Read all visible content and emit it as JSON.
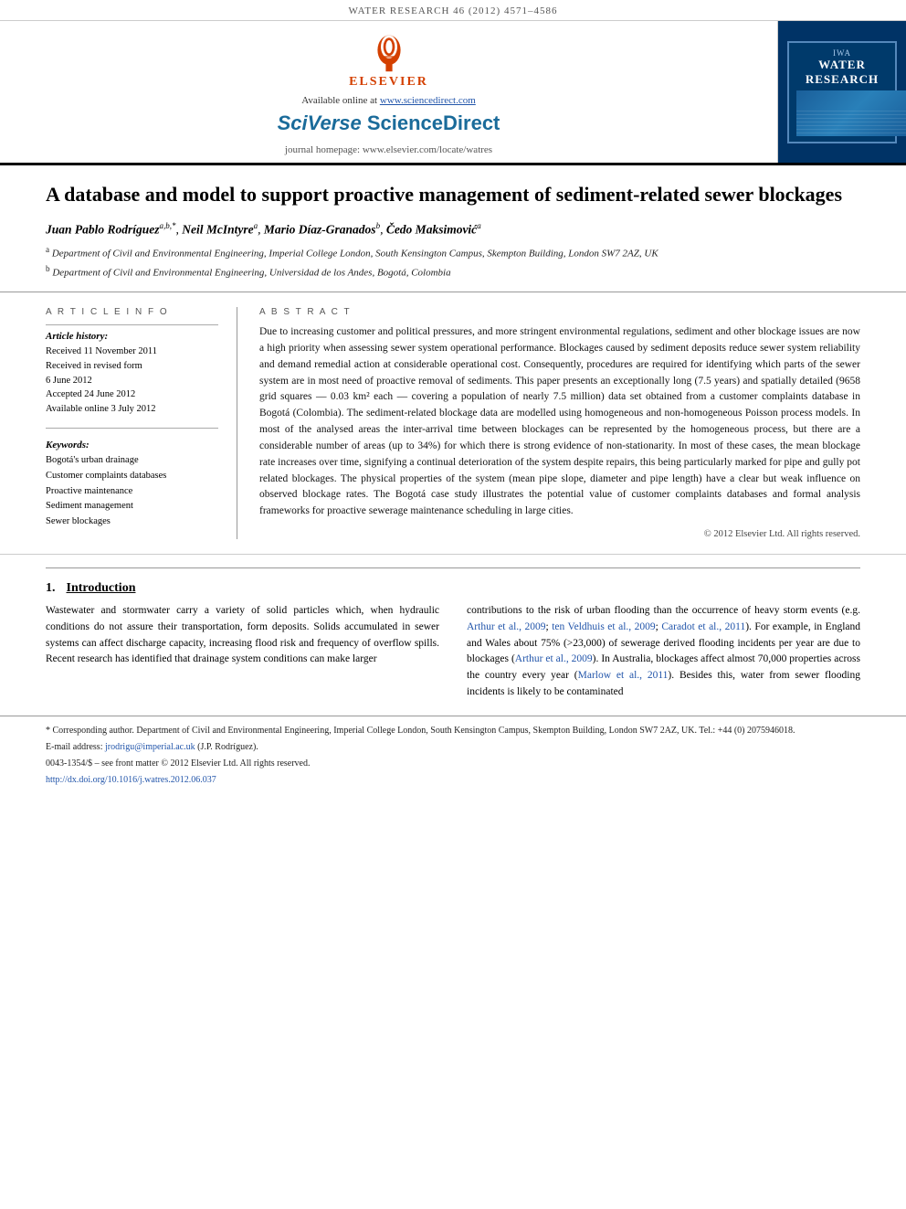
{
  "journal_header": {
    "journal_ref": "WATER RESEARCH 46 (2012) 4571–4586"
  },
  "header": {
    "available_text": "Available online at www.sciencedirect.com",
    "sciverse_text": "SciVerse ScienceDirect",
    "journal_homepage": "journal homepage: www.elsevier.com/locate/watres",
    "elsevier_label": "ELSEVIER",
    "water_research_label": "WATER RESEARCH",
    "iwa_label": "IWA"
  },
  "article": {
    "title": "A database and model to support proactive management of sediment-related sewer blockages",
    "authors_line": "Juan Pablo Rodríguez a,b,*, Neil McIntyre a, Mario Díaz-Granados b, Čedo Maksimović a",
    "authors": [
      {
        "name": "Juan Pablo Rodríguez",
        "sup": "a,b,*"
      },
      {
        "name": "Neil McIntyre",
        "sup": "a"
      },
      {
        "name": "Mario Díaz-Granados",
        "sup": "b"
      },
      {
        "name": "Čedo Maksimović",
        "sup": "a"
      }
    ],
    "affiliations": [
      {
        "sup": "a",
        "text": "Department of Civil and Environmental Engineering, Imperial College London, South Kensington Campus, Skempton Building, London SW7 2AZ, UK"
      },
      {
        "sup": "b",
        "text": "Department of Civil and Environmental Engineering, Universidad de los Andes, Bogotá, Colombia"
      }
    ]
  },
  "article_info": {
    "heading": "A R T I C L E   I N F O",
    "history_label": "Article history:",
    "history": [
      "Received 11 November 2011",
      "Received in revised form",
      "6 June 2012",
      "Accepted 24 June 2012",
      "Available online 3 July 2012"
    ],
    "keywords_label": "Keywords:",
    "keywords": [
      "Bogotá's urban drainage",
      "Customer complaints databases",
      "Proactive maintenance",
      "Sediment management",
      "Sewer blockages"
    ]
  },
  "abstract": {
    "heading": "A B S T R A C T",
    "text": "Due to increasing customer and political pressures, and more stringent environmental regulations, sediment and other blockage issues are now a high priority when assessing sewer system operational performance. Blockages caused by sediment deposits reduce sewer system reliability and demand remedial action at considerable operational cost. Consequently, procedures are required for identifying which parts of the sewer system are in most need of proactive removal of sediments. This paper presents an exceptionally long (7.5 years) and spatially detailed (9658 grid squares — 0.03 km² each — covering a population of nearly 7.5 million) data set obtained from a customer complaints database in Bogotá (Colombia). The sediment-related blockage data are modelled using homogeneous and non-homogeneous Poisson process models. In most of the analysed areas the inter-arrival time between blockages can be represented by the homogeneous process, but there are a considerable number of areas (up to 34%) for which there is strong evidence of non-stationarity. In most of these cases, the mean blockage rate increases over time, signifying a continual deterioration of the system despite repairs, this being particularly marked for pipe and gully pot related blockages. The physical properties of the system (mean pipe slope, diameter and pipe length) have a clear but weak influence on observed blockage rates. The Bogotá case study illustrates the potential value of customer complaints databases and formal analysis frameworks for proactive sewerage maintenance scheduling in large cities.",
    "copyright": "© 2012 Elsevier Ltd. All rights reserved."
  },
  "introduction": {
    "number": "1.",
    "title": "Introduction",
    "left_col": "Wastewater and stormwater carry a variety of solid particles which, when hydraulic conditions do not assure their transportation, form deposits. Solids accumulated in sewer systems can affect discharge capacity, increasing flood risk and frequency of overflow spills. Recent research has identified that drainage system conditions can make larger",
    "right_col": "contributions to the risk of urban flooding than the occurrence of heavy storm events (e.g. Arthur et al., 2009; ten Veldhuis et al., 2009; Caradot et al., 2011). For example, in England and Wales about 75% (>23,000) of sewerage derived flooding incidents per year are due to blockages (Arthur et al., 2009). In Australia, blockages affect almost 70,000 properties across the country every year (Marlow et al., 2011). Besides this, water from sewer flooding incidents is likely to be contaminated"
  },
  "footnote": {
    "corresponding_author": "* Corresponding author. Department of Civil and Environmental Engineering, Imperial College London, South Kensington Campus, Skempton Building, London SW7 2AZ, UK. Tel.: +44 (0) 2075946018.",
    "email_line": "E-mail address: jrodrigu@imperial.ac.uk (J.P. Rodríguez).",
    "copyright_line": "0043-1354/$ – see front matter © 2012 Elsevier Ltd. All rights reserved.",
    "doi_line": "http://dx.doi.org/10.1016/j.watres.2012.06.037"
  }
}
